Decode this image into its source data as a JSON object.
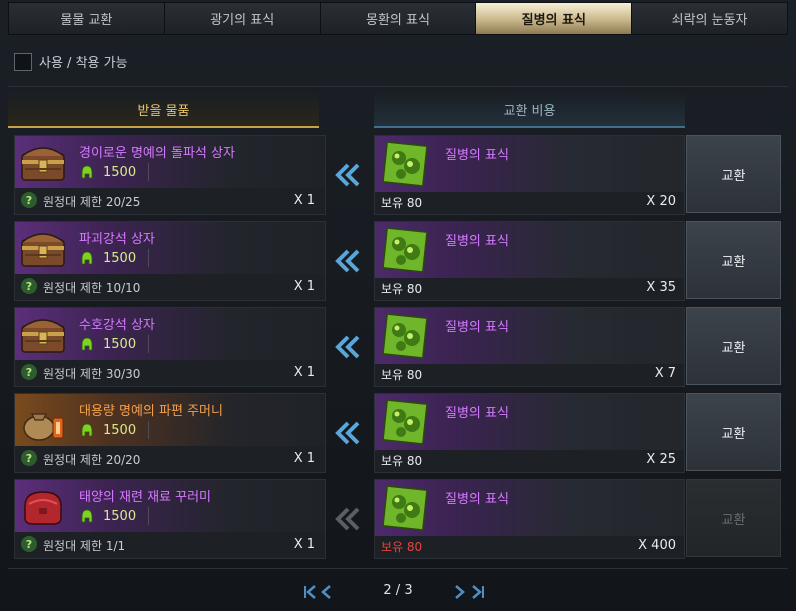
{
  "tabs": [
    {
      "label": "물물 교환",
      "active": false
    },
    {
      "label": "광기의 표식",
      "active": false
    },
    {
      "label": "몽환의 표식",
      "active": false
    },
    {
      "label": "질병의 표식",
      "active": true
    },
    {
      "label": "쇠락의 눈동자",
      "active": false
    }
  ],
  "filter": {
    "label": "사용 / 착용 가능",
    "checked": false
  },
  "columns": {
    "receive": "받을 물품",
    "cost": "교환 비용"
  },
  "rows": [
    {
      "item_name": "경이로운 명예의 돌파석 상자",
      "item_icon": "chest-icon",
      "honor": "1500",
      "limit": "원정대 제한 20/25",
      "receive_qty": "X 1",
      "cost_name": "질병의 표식",
      "owned": "보유 80",
      "cost_qty": "X 20",
      "button": "교환",
      "enabled": true
    },
    {
      "item_name": "파괴강석 상자",
      "item_icon": "chest-icon",
      "honor": "1500",
      "limit": "원정대 제한 10/10",
      "receive_qty": "X 1",
      "cost_name": "질병의 표식",
      "owned": "보유 80",
      "cost_qty": "X 35",
      "button": "교환",
      "enabled": true
    },
    {
      "item_name": "수호강석 상자",
      "item_icon": "chest-icon",
      "honor": "1500",
      "limit": "원정대 제한 30/30",
      "receive_qty": "X 1",
      "cost_name": "질병의 표식",
      "owned": "보유 80",
      "cost_qty": "X 7",
      "button": "교환",
      "enabled": true
    },
    {
      "item_name": "대용량 명예의 파편 주머니",
      "item_icon": "pouch-icon",
      "honor": "1500",
      "limit": "원정대 제한 20/20",
      "receive_qty": "X 1",
      "cost_name": "질병의 표식",
      "owned": "보유 80",
      "cost_qty": "X 25",
      "button": "교환",
      "enabled": true
    },
    {
      "item_name": "태양의 재련 재료 꾸러미",
      "item_icon": "bag-icon",
      "honor": "1500",
      "limit": "원정대 제한 1/1",
      "receive_qty": "X 1",
      "cost_name": "질병의 표식",
      "owned": "보유 80",
      "cost_qty": "X 400",
      "button": "교환",
      "enabled": false
    }
  ],
  "pager": {
    "text": "2 / 3"
  },
  "colors": {
    "accent_gold": "#e8c46a",
    "purple_text": "#d67aff",
    "orange_text": "#f5a04a",
    "insufficient_red": "#e8443e",
    "arrow_blue": "#5aa6d8"
  }
}
